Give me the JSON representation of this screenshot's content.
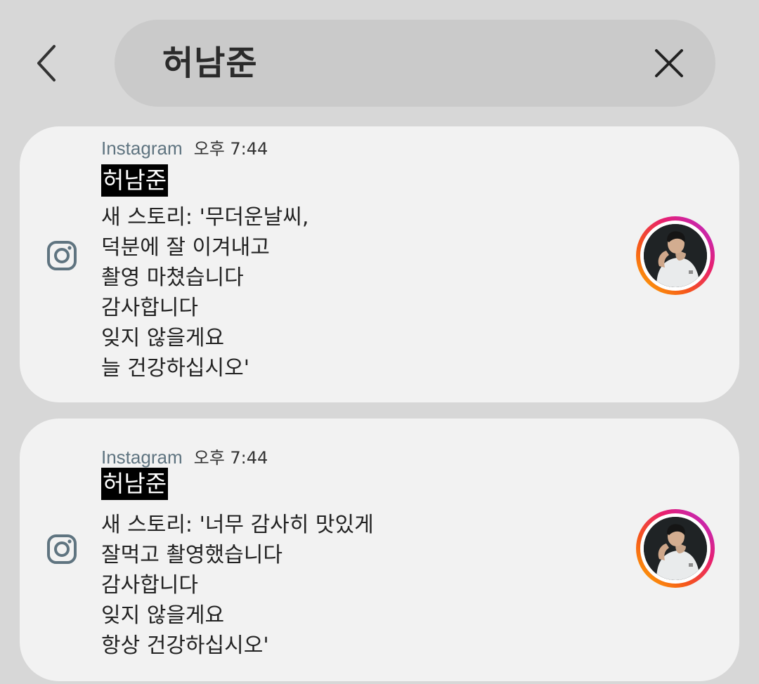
{
  "search": {
    "query": "허남준"
  },
  "notifications": [
    {
      "app_name": "Instagram",
      "time": "오후 7:44",
      "sender": "허남준",
      "lines": [
        "새 스토리: '무더운날씨,",
        "덕분에 잘 이겨내고",
        "촬영 마쳤습니다",
        "감사합니다",
        "잊지 않을게요",
        "늘 건강하십시오'"
      ]
    },
    {
      "app_name": "Instagram",
      "time": "오후 7:44",
      "sender": "허남준",
      "lines": [
        "새 스토리: '너무 감사히 맛있게",
        "잘먹고 촬영했습니다",
        "감사합니다",
        "잊지 않을게요",
        "항상 건강하십시오'"
      ]
    }
  ],
  "icons": {
    "back": "chevron-left-icon",
    "clear": "close-icon",
    "app": "instagram-icon"
  },
  "colors": {
    "background": "#d7d7d7",
    "search_bar": "#cacaca",
    "card": "#f2f2f2",
    "app_name": "#5f7480",
    "sender_highlight": "#000000",
    "story_ring_start": "#ffb400",
    "story_ring_end": "#b22bd6"
  }
}
